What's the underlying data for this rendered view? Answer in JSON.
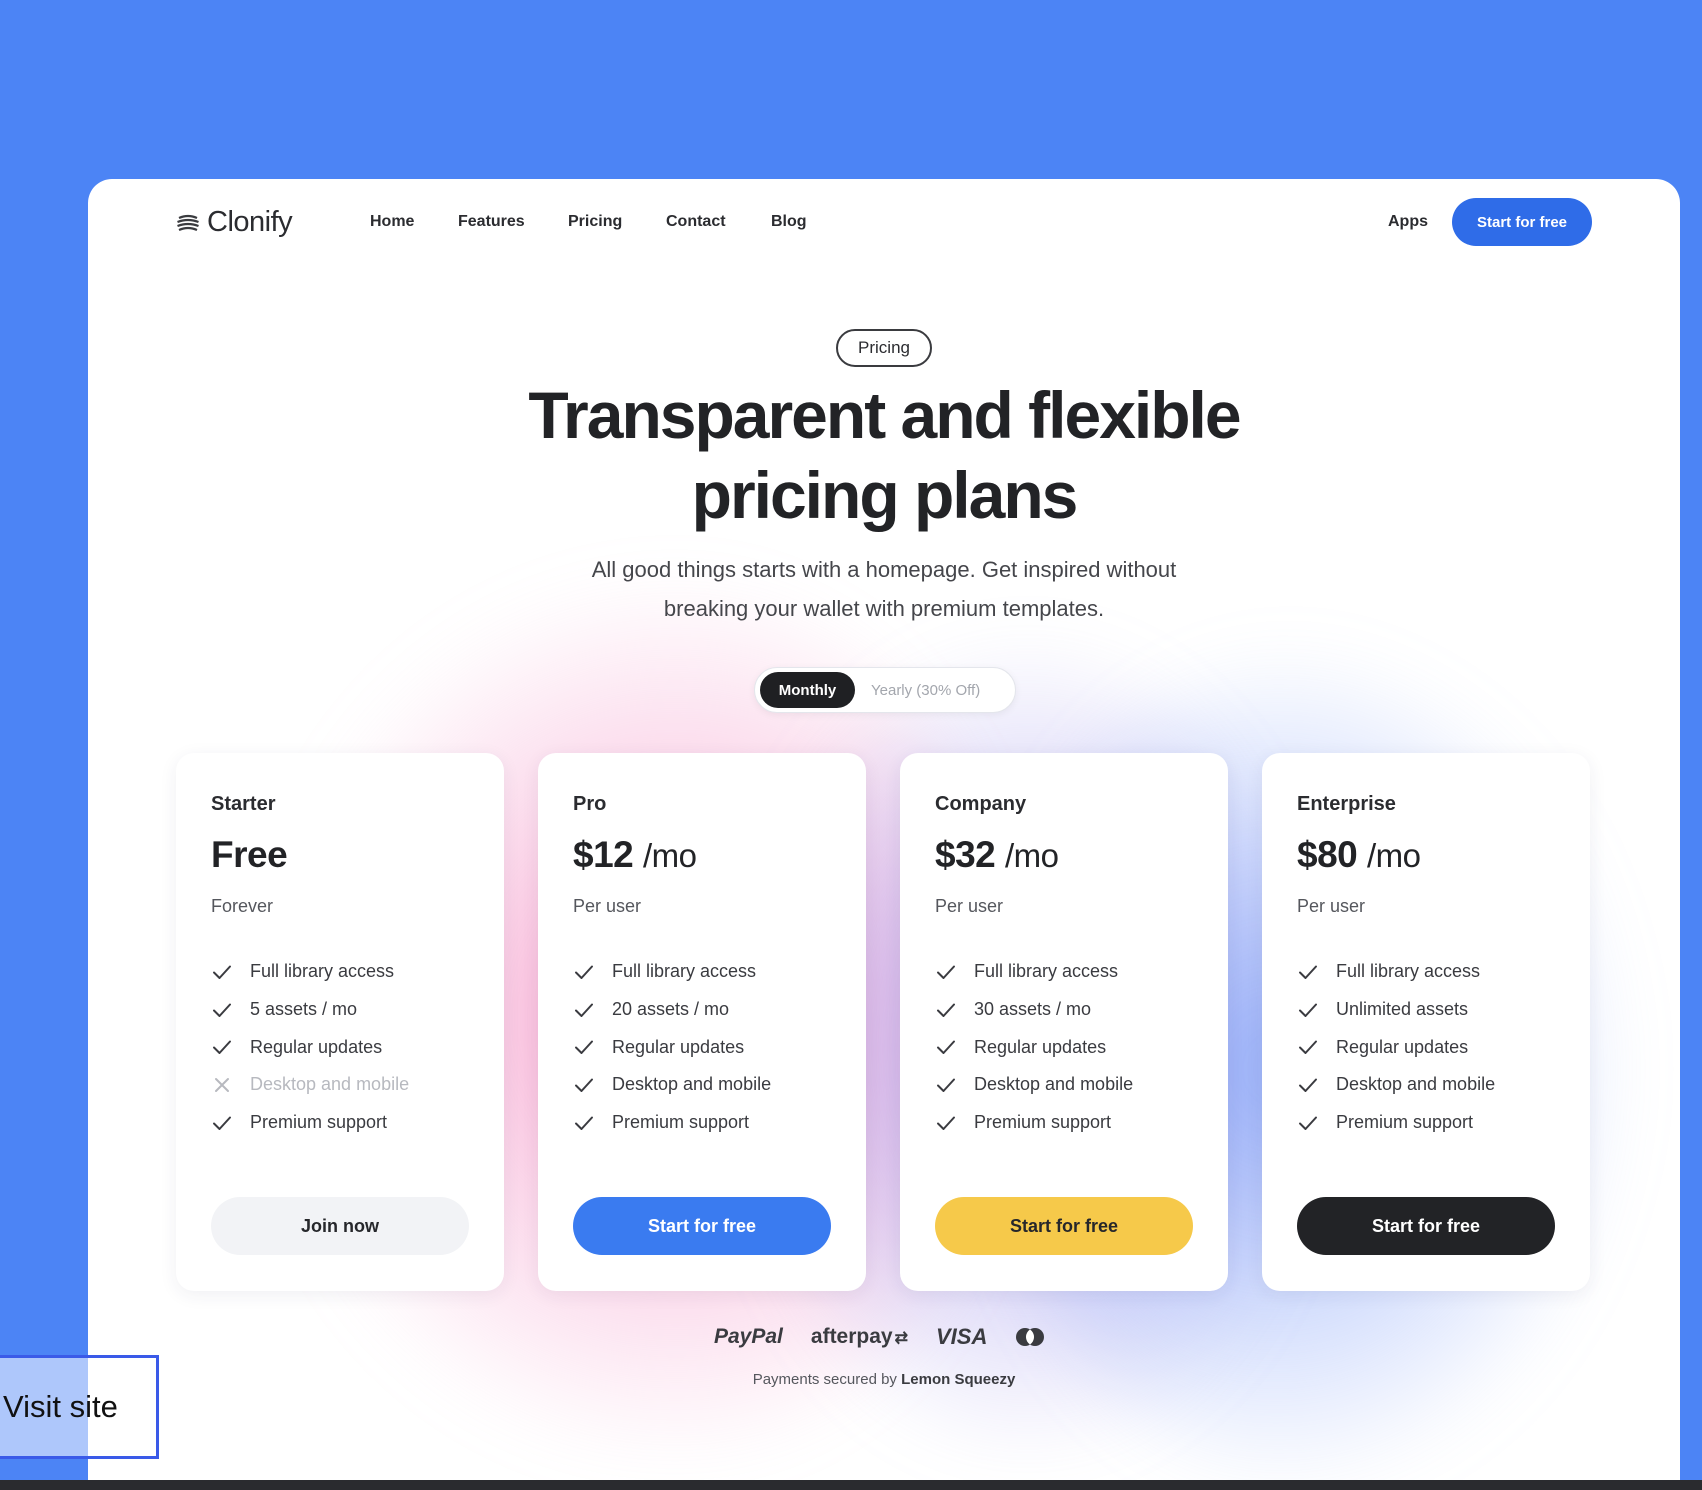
{
  "nav": {
    "brand": "Clonify",
    "links": [
      "Home",
      "Features",
      "Pricing",
      "Contact",
      "Blog"
    ],
    "apps": "Apps",
    "cta": "Start for free"
  },
  "hero": {
    "tag": "Pricing",
    "title_line1": "Transparent and flexible",
    "title_line2": "pricing plans",
    "subtitle_line1": "All good things starts with a homepage. Get inspired without",
    "subtitle_line2": "breaking your wallet with premium templates."
  },
  "billing_toggle": {
    "selected": "Monthly",
    "other": "Yearly (30% Off)"
  },
  "plans": [
    {
      "name": "Starter",
      "price": "Free",
      "unit": "",
      "period": "Forever",
      "features": [
        {
          "label": "Full library access",
          "included": true
        },
        {
          "label": "5 assets / mo",
          "included": true
        },
        {
          "label": "Regular updates",
          "included": true
        },
        {
          "label": "Desktop and mobile",
          "included": false
        },
        {
          "label": "Premium support",
          "included": true
        }
      ],
      "button": "Join now"
    },
    {
      "name": "Pro",
      "price": "$12",
      "unit": "/mo",
      "period": "Per user",
      "features": [
        {
          "label": "Full library access",
          "included": true
        },
        {
          "label": "20 assets / mo",
          "included": true
        },
        {
          "label": "Regular updates",
          "included": true
        },
        {
          "label": "Desktop and mobile",
          "included": true
        },
        {
          "label": "Premium support",
          "included": true
        }
      ],
      "button": "Start for free"
    },
    {
      "name": "Company",
      "price": "$32",
      "unit": "/mo",
      "period": "Per user",
      "features": [
        {
          "label": "Full library access",
          "included": true
        },
        {
          "label": "30 assets / mo",
          "included": true
        },
        {
          "label": "Regular updates",
          "included": true
        },
        {
          "label": "Desktop and mobile",
          "included": true
        },
        {
          "label": "Premium support",
          "included": true
        }
      ],
      "button": "Start for free"
    },
    {
      "name": "Enterprise",
      "price": "$80",
      "unit": "/mo",
      "period": "Per user",
      "features": [
        {
          "label": "Full library access",
          "included": true
        },
        {
          "label": "Unlimited assets",
          "included": true
        },
        {
          "label": "Regular updates",
          "included": true
        },
        {
          "label": "Desktop and mobile",
          "included": true
        },
        {
          "label": "Premium support",
          "included": true
        }
      ],
      "button": "Start for free"
    }
  ],
  "payments": {
    "logos": [
      "PayPal",
      "afterpay",
      "VISA"
    ],
    "mastercard_icon": "mastercard-icon",
    "secured_prefix": "Payments secured by",
    "secured_brand": "Lemon Squeezy"
  },
  "overlay": {
    "visit_site": "Visit site"
  },
  "colors": {
    "background": "#4c84f5",
    "primary": "#2f6ce8",
    "yellow": "#f6c94a",
    "dark": "#222326"
  }
}
